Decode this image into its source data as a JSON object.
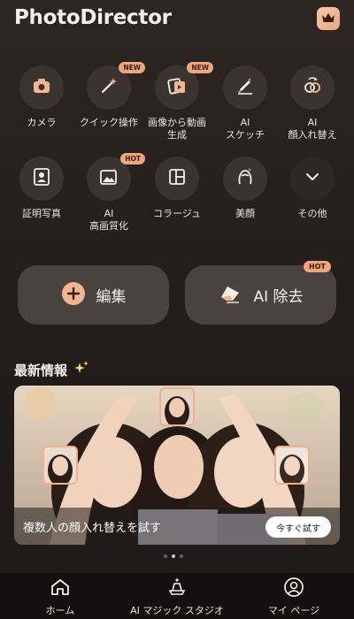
{
  "header": {
    "title": "PhotoDirector",
    "premium_icon": "crown-icon"
  },
  "tools_row1": [
    {
      "label": "カメラ",
      "icon": "camera-icon",
      "badge": ""
    },
    {
      "label": "クイック操作",
      "icon": "magic-wand-icon",
      "badge": "NEW"
    },
    {
      "label": "画像から動画\n生成",
      "icon": "photo-to-video-icon",
      "badge": "NEW"
    },
    {
      "label": "AI\nスケッチ",
      "icon": "sketch-brush-icon",
      "badge": ""
    },
    {
      "label": "AI\n顔入れ替え",
      "icon": "face-swap-icon",
      "badge": ""
    }
  ],
  "tools_row2": [
    {
      "label": "証明写真",
      "icon": "id-photo-icon",
      "badge": ""
    },
    {
      "label": "AI\n高画質化",
      "icon": "enhance-image-icon",
      "badge": "HOT"
    },
    {
      "label": "コラージュ",
      "icon": "collage-icon",
      "badge": ""
    },
    {
      "label": "美顔",
      "icon": "face-beauty-icon",
      "badge": ""
    },
    {
      "label": "その他",
      "icon": "chevron-down-icon",
      "badge": ""
    }
  ],
  "actions": {
    "edit_label": "編集",
    "ai_remove_label": "AI 除去",
    "ai_remove_badge": "HOT"
  },
  "news": {
    "title": "最新情報",
    "banner_text": "複数人の顔入れ替えを試す",
    "try_button": "今すぐ試す",
    "carousel_pages": 3,
    "carousel_active": 2
  },
  "bottom_nav": [
    {
      "label": "ホーム",
      "icon": "home-icon"
    },
    {
      "label": "AI マジック スタジオ",
      "icon": "magic-hat-icon"
    },
    {
      "label": "マイ ページ",
      "icon": "user-icon"
    }
  ],
  "colors": {
    "accent": "#f0a67c",
    "background": "#231e1c",
    "button": "#4a423e"
  }
}
